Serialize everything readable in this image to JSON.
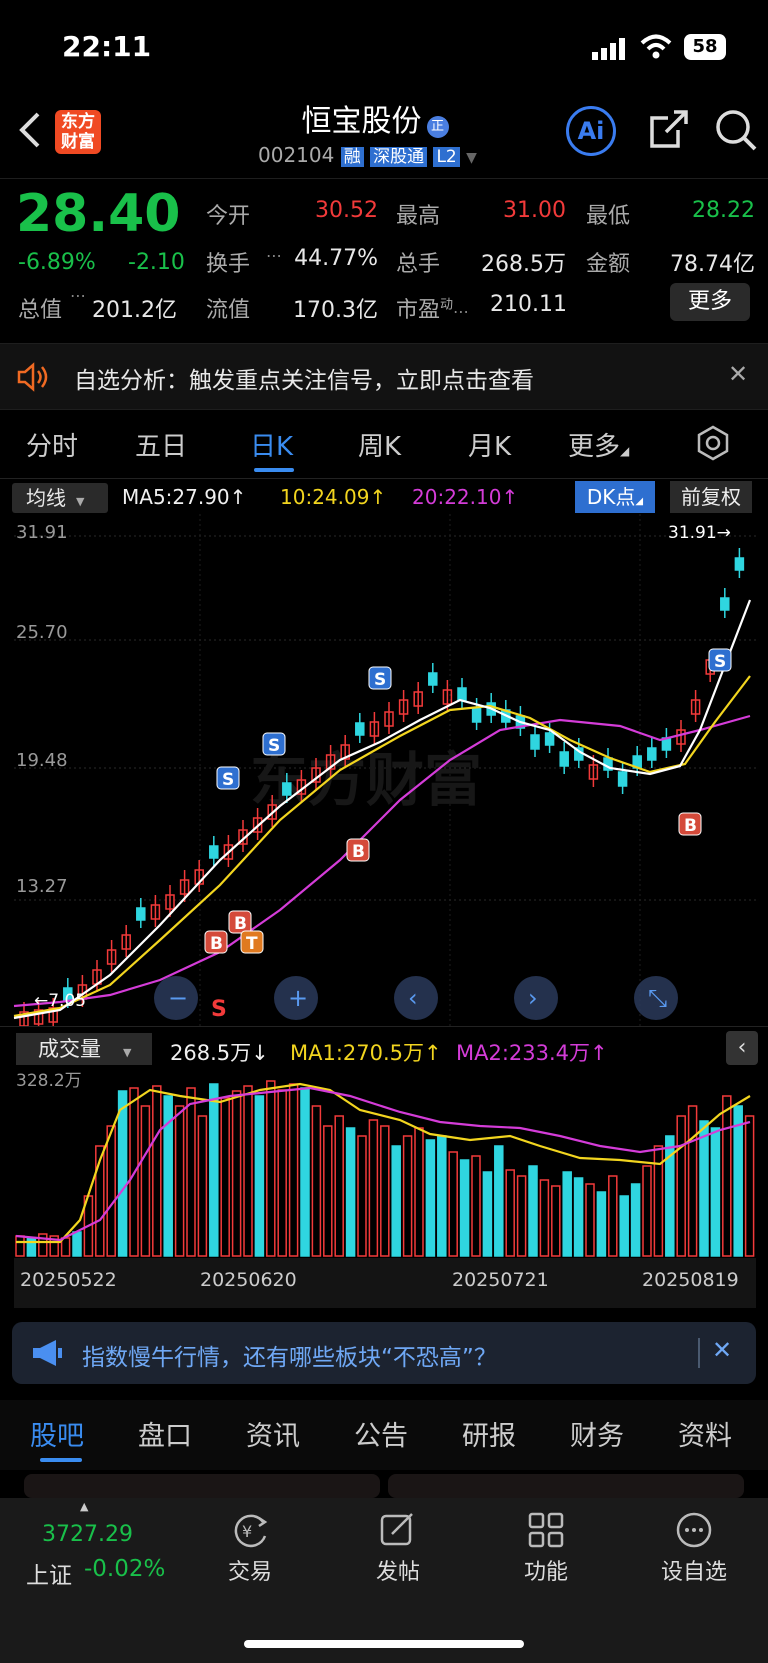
{
  "status_bar": {
    "time": "22:11",
    "battery": "58"
  },
  "header": {
    "stock_name": "恒宝股份",
    "badge": "正",
    "code": "002104",
    "tags": [
      "融",
      "深股通",
      "L2"
    ],
    "logo_text": [
      "东方",
      "财富"
    ],
    "ai_label": "Ai"
  },
  "quote": {
    "price": "28.40",
    "change_pct": "-6.89%",
    "change": "-2.10",
    "stats": [
      {
        "label": "今开",
        "value": "30.52",
        "color": "#f23a3a"
      },
      {
        "label": "最高",
        "value": "31.00",
        "color": "#f23a3a"
      },
      {
        "label": "最低",
        "value": "28.22",
        "color": "#19c04a"
      },
      {
        "label": "换手",
        "value": "44.77%",
        "color": "#e8e8e8"
      },
      {
        "label": "总手",
        "value": "268.5万",
        "color": "#e8e8e8"
      },
      {
        "label": "金额",
        "value": "78.74亿",
        "color": "#e8e8e8"
      },
      {
        "label": "总值",
        "value": "201.2亿",
        "color": "#e8e8e8"
      },
      {
        "label": "流值",
        "value": "170.3亿",
        "color": "#e8e8e8"
      },
      {
        "label": "市盈",
        "sup": "动",
        "value": "210.11",
        "color": "#e8e8e8"
      }
    ],
    "more_label": "更多"
  },
  "alert": {
    "text": "自选分析：触发重点关注信号，立即点击查看"
  },
  "period_tabs": [
    "分时",
    "五日",
    "日K",
    "周K",
    "月K",
    "更多"
  ],
  "active_tab": 2,
  "ma_bar": {
    "selector": "均线",
    "ma5": "MA5:27.90↑",
    "ma10": "10:24.09↑",
    "ma20": "20:22.10↑",
    "dk": "DK点",
    "fq": "前复权"
  },
  "chart_axis": {
    "y_labels": [
      "31.91",
      "25.70",
      "19.48",
      "13.27"
    ],
    "high_marker": "31.91→",
    "low_marker": "←7.05"
  },
  "chart_controls": [
    "zoom-out",
    "zoom-in",
    "prev",
    "next",
    "fullscreen"
  ],
  "signals": [
    "S",
    "S",
    "S",
    "S",
    "B",
    "B",
    "B",
    "T",
    "B",
    "S"
  ],
  "volume_bar": {
    "selector": "成交量",
    "vol": "268.5万↓",
    "ma1": "MA1:270.5万↑",
    "ma2": "MA2:233.4万↑",
    "max_label": "328.2万"
  },
  "dates": [
    "20250522",
    "20250620",
    "20250721",
    "20250819"
  ],
  "news": {
    "text": "指数慢牛行情，还有哪些板块“不恐高”？"
  },
  "bottom_tabs": [
    "股吧",
    "盘口",
    "资讯",
    "公告",
    "研报",
    "财务",
    "资料"
  ],
  "active_bottom_tab": 0,
  "footer": {
    "index_value": "3727.29",
    "index_name": "上证",
    "index_change": "-0.02%",
    "items": [
      {
        "label": "交易",
        "icon": "trade-icon"
      },
      {
        "label": "发帖",
        "icon": "post-icon"
      },
      {
        "label": "功能",
        "icon": "apps-icon"
      },
      {
        "label": "设自选",
        "icon": "more-icon"
      }
    ]
  }
}
